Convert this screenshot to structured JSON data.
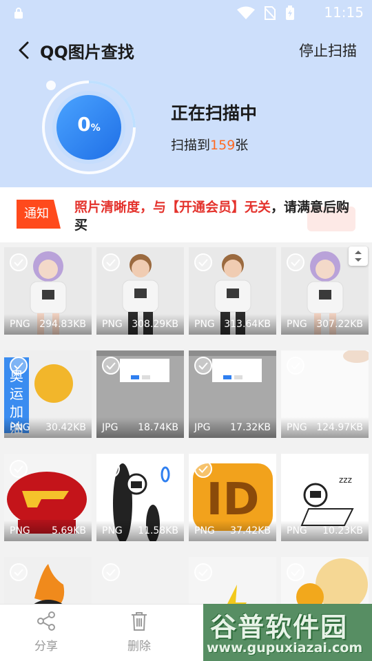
{
  "status_bar": {
    "time": "11:15"
  },
  "nav": {
    "title": "QQ图片查找",
    "stop_label": "停止扫描"
  },
  "scan": {
    "progress_value": "0",
    "progress_unit": "%",
    "title": "正在扫描中",
    "count_prefix": "扫描到",
    "count": "159",
    "count_suffix": "张"
  },
  "notice": {
    "tag": "通知",
    "part1": "照片清晰度，与【开通会员】无关",
    "part2": "，请满意后购买"
  },
  "images": [
    {
      "format": "PNG",
      "size": "294.83KB",
      "icon": "avatar-girl-image"
    },
    {
      "format": "PNG",
      "size": "308.29KB",
      "icon": "avatar-boy-image"
    },
    {
      "format": "PNG",
      "size": "313.64KB",
      "icon": "avatar-boy-image"
    },
    {
      "format": "PNG",
      "size": "307.22KB",
      "icon": "avatar-girl-image"
    },
    {
      "format": "PNG",
      "size": "30.42KB",
      "icon": "olympic-badge-image"
    },
    {
      "format": "JPG",
      "size": "18.74KB",
      "icon": "dialog-screenshot-image"
    },
    {
      "format": "JPG",
      "size": "17.32KB",
      "icon": "dialog-screenshot-image"
    },
    {
      "format": "PNG",
      "size": "124.97KB",
      "icon": "blank-image"
    },
    {
      "format": "PNG",
      "size": "5.69KB",
      "icon": "cf-logo-image"
    },
    {
      "format": "PNG",
      "size": "11.58KB",
      "icon": "astronaut-sticker-image"
    },
    {
      "format": "PNG",
      "size": "37.42KB",
      "icon": "id-badge-image"
    },
    {
      "format": "PNG",
      "size": "10.23KB",
      "icon": "astronaut-laptop-image"
    },
    {
      "format": "",
      "size": "",
      "icon": "flame-avatar-image"
    },
    {
      "format": "",
      "size": "",
      "icon": "placeholder-image"
    },
    {
      "format": "",
      "size": "",
      "icon": "lightning-image"
    },
    {
      "format": "",
      "size": "",
      "icon": "orange-ball-image"
    }
  ],
  "toolbar": {
    "share_label": "分享",
    "delete_label": "删除"
  },
  "watermark": {
    "title": "谷普软件园",
    "url": "www.gupuxiazai.com"
  },
  "colors": {
    "header_bg": "#cddffb",
    "accent_blue": "#2f7ff0",
    "accent_orange": "#ff6a22",
    "notice_red": "#e4332d"
  }
}
